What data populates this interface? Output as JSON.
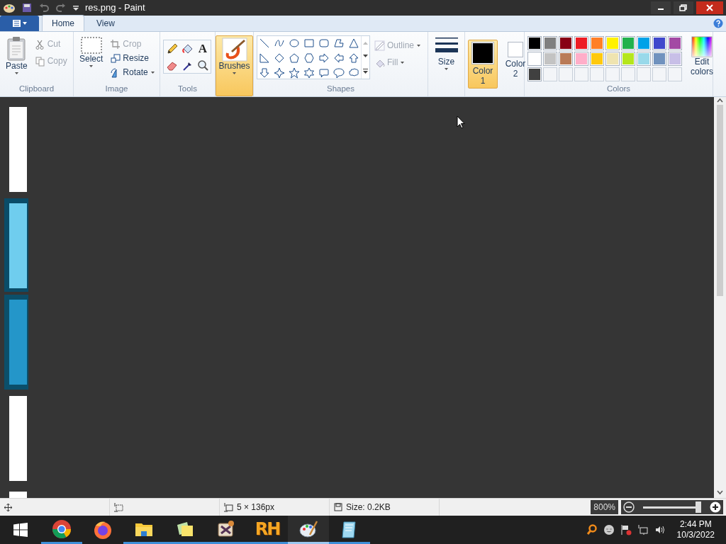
{
  "window": {
    "title": "res.png - Paint"
  },
  "tabs": [
    {
      "label": "Home",
      "selected": true
    },
    {
      "label": "View",
      "selected": false
    }
  ],
  "clipboard": {
    "label": "Clipboard",
    "paste": "Paste",
    "items": [
      {
        "label": "Cut",
        "kind": "cut",
        "disabled": true
      },
      {
        "label": "Copy",
        "kind": "copy",
        "disabled": true
      }
    ]
  },
  "image": {
    "label": "Image",
    "select": "Select",
    "items": [
      {
        "label": "Crop",
        "kind": "crop",
        "disabled": true
      },
      {
        "label": "Resize",
        "kind": "resize",
        "disabled": false
      },
      {
        "label": "Rotate",
        "kind": "rotate",
        "disabled": false
      }
    ]
  },
  "tools": {
    "label": "Tools",
    "text_tool_glyph": "A"
  },
  "brushes": {
    "label": "Brushes",
    "selected": true
  },
  "shapes": {
    "label": "Shapes",
    "items": [
      {
        "label": "Outline",
        "kind": "outline",
        "disabled": true
      },
      {
        "label": "Fill",
        "kind": "fill",
        "disabled": true
      }
    ]
  },
  "size": {
    "label": "Size"
  },
  "color_selectors": [
    {
      "label": "Color 1",
      "color": "#000000",
      "selected": true
    },
    {
      "label": "Color 2",
      "color": "#ffffff",
      "selected": false
    }
  ],
  "colors": {
    "label": "Colors",
    "edit": "Edit colors",
    "swatches": [
      {
        "kind": "color",
        "color": "#000000"
      },
      {
        "kind": "color",
        "color": "#7f7f7f"
      },
      {
        "kind": "color",
        "color": "#880015"
      },
      {
        "kind": "color",
        "color": "#ed1c24"
      },
      {
        "kind": "color",
        "color": "#ff7f27"
      },
      {
        "kind": "color",
        "color": "#fff200"
      },
      {
        "kind": "color",
        "color": "#22b14c"
      },
      {
        "kind": "color",
        "color": "#00a2e8"
      },
      {
        "kind": "color",
        "color": "#3f48cc"
      },
      {
        "kind": "color",
        "color": "#a349a4"
      },
      {
        "kind": "color",
        "color": "#ffffff"
      },
      {
        "kind": "color",
        "color": "#c3c3c3"
      },
      {
        "kind": "color",
        "color": "#b97a57"
      },
      {
        "kind": "color",
        "color": "#ffaec9"
      },
      {
        "kind": "color",
        "color": "#ffc90e"
      },
      {
        "kind": "color",
        "color": "#efe4b0"
      },
      {
        "kind": "color",
        "color": "#b5e61d"
      },
      {
        "kind": "color",
        "color": "#99d9ea"
      },
      {
        "kind": "color",
        "color": "#7092be"
      },
      {
        "kind": "color",
        "color": "#c8bfe7"
      },
      {
        "kind": "color",
        "color": "#404040"
      },
      {
        "kind": "empty"
      },
      {
        "kind": "empty"
      },
      {
        "kind": "empty"
      },
      {
        "kind": "empty"
      },
      {
        "kind": "empty"
      },
      {
        "kind": "empty"
      },
      {
        "kind": "empty"
      },
      {
        "kind": "empty"
      },
      {
        "kind": "empty"
      }
    ]
  },
  "status_bar": {
    "dimensions": "5 × 136px",
    "file_size": "Size: 0.2KB",
    "zoom": "800%",
    "zoom_slider": {
      "level": 0.95
    }
  },
  "taskbar": {
    "apps": [
      {
        "kind": "chrome",
        "running": true,
        "selected": false
      },
      {
        "kind": "firefox",
        "running": false,
        "selected": false
      },
      {
        "kind": "folder",
        "running": true,
        "selected": false
      },
      {
        "kind": "notes",
        "running": true,
        "selected": false
      },
      {
        "kind": "media",
        "running": true,
        "selected": false
      },
      {
        "kind": "rh",
        "label": "RH",
        "running": true,
        "selected": false
      },
      {
        "kind": "paint",
        "running": true,
        "selected": true
      },
      {
        "kind": "notepad",
        "running": true,
        "selected": false
      }
    ],
    "time": "2:44 PM",
    "date": "10/3/2022"
  }
}
